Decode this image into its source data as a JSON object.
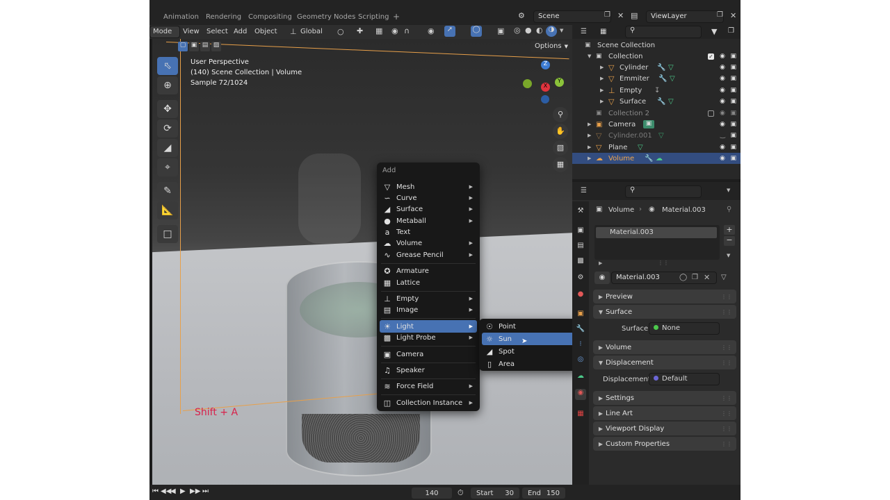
{
  "workspace_tabs": [
    "Animation",
    "Rendering",
    "Compositing",
    "Geometry Nodes",
    "Scripting"
  ],
  "add_workspace": "+",
  "scene": {
    "name": "Scene",
    "view_layer": "ViewLayer"
  },
  "header": {
    "mode": "Mode",
    "menus": [
      "View",
      "Select",
      "Add",
      "Object"
    ],
    "orientation": "Global",
    "options": "Options"
  },
  "overlay": {
    "line1": "User Perspective",
    "line2": "(140) Scene Collection | Volume",
    "line3": "Sample 72/1024",
    "shortcut": "Shift + A"
  },
  "gizmo": {
    "z": "Z",
    "y": "Y",
    "x": "X"
  },
  "add_menu": {
    "title": "Add",
    "items": [
      {
        "label": "Mesh",
        "icon": "mesh-icon",
        "submenu": true
      },
      {
        "label": "Curve",
        "icon": "curve-icon",
        "submenu": true
      },
      {
        "label": "Surface",
        "icon": "surface-icon",
        "submenu": true
      },
      {
        "label": "Metaball",
        "icon": "metaball-icon",
        "submenu": true
      },
      {
        "label": "Text",
        "icon": "text-icon",
        "submenu": false
      },
      {
        "label": "Volume",
        "icon": "volume-icon",
        "submenu": true
      },
      {
        "label": "Grease Pencil",
        "icon": "grease-pencil-icon",
        "submenu": true
      },
      {
        "label": "Armature",
        "icon": "armature-icon",
        "submenu": false
      },
      {
        "label": "Lattice",
        "icon": "lattice-icon",
        "submenu": false
      },
      {
        "label": "Empty",
        "icon": "empty-icon",
        "submenu": true
      },
      {
        "label": "Image",
        "icon": "image-icon",
        "submenu": true
      },
      {
        "label": "Light",
        "icon": "light-icon",
        "submenu": true
      },
      {
        "label": "Light Probe",
        "icon": "light-probe-icon",
        "submenu": true
      },
      {
        "label": "Camera",
        "icon": "camera-icon",
        "submenu": false
      },
      {
        "label": "Speaker",
        "icon": "speaker-icon",
        "submenu": false
      },
      {
        "label": "Force Field",
        "icon": "force-field-icon",
        "submenu": true
      },
      {
        "label": "Collection Instance",
        "icon": "collection-instance-icon",
        "submenu": true
      }
    ]
  },
  "light_submenu": [
    "Point",
    "Sun",
    "Spot",
    "Area"
  ],
  "outliner": {
    "root": "Scene Collection",
    "rows": [
      {
        "label": "Collection",
        "indent": 1
      },
      {
        "label": "Cylinder",
        "indent": 2
      },
      {
        "label": "Emmiter",
        "indent": 2
      },
      {
        "label": "Empty",
        "indent": 2
      },
      {
        "label": "Surface",
        "indent": 2
      },
      {
        "label": "Collection 2",
        "indent": 1
      },
      {
        "label": "Camera",
        "indent": 1
      },
      {
        "label": "Cylinder.001",
        "indent": 1
      },
      {
        "label": "Plane",
        "indent": 1
      },
      {
        "label": "Volume",
        "indent": 1,
        "selected": true
      }
    ]
  },
  "properties": {
    "breadcrumb_object": "Volume",
    "breadcrumb_material": "Material.003",
    "slot": "Material.003",
    "material_name": "Material.003",
    "panels": {
      "preview": "Preview",
      "surface": "Surface",
      "surface_label": "Surface",
      "surface_value": "None",
      "volume": "Volume",
      "displacement": "Displacement",
      "displacement_label": "Displacement",
      "displacement_value": "Default",
      "settings": "Settings",
      "line_art": "Line Art",
      "viewport_display": "Viewport Display",
      "custom_properties": "Custom Properties"
    }
  },
  "timeline": {
    "current_frame": "140",
    "start_label": "Start",
    "start": "30",
    "end_label": "End",
    "end": "150"
  },
  "colors": {
    "accent": "#4772b3",
    "object_orange": "#e8a04a",
    "selection": "#334d80",
    "shortcut_red": "#d8204a"
  }
}
